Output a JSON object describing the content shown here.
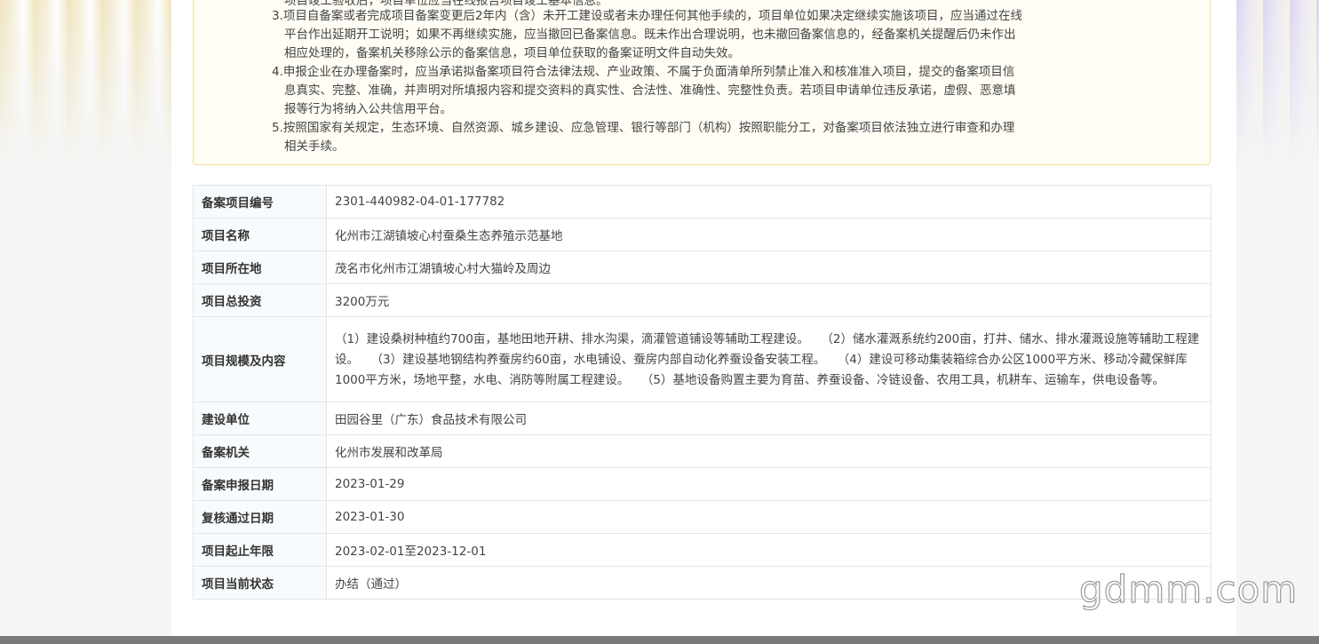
{
  "notice": {
    "lines": [
      "项目竣工验收后，项目单位应当在线报告项目竣工基本信息。",
      "3.项目自备案或者完成项目备案变更后2年内（含）未开工建设或者未办理任何其他手续的，项目单位如果决定继续实施该项目，应当通过在线",
      "平台作出延期开工说明；如果不再继续实施，应当撤回已备案信息。既未作出合理说明，也未撤回备案信息的，经备案机关提醒后仍未作出",
      "相应处理的，备案机关移除公示的备案信息，项目单位获取的备案证明文件自动失效。",
      "4.申报企业在办理备案时，应当承诺拟备案项目符合法律法规、产业政策、不属于负面清单所列禁止准入和核准准入项目，提交的备案项目信",
      "息真实、完整、准确，并声明对所填报内容和提交资料的真实性、合法性、准确性、完整性负责。若项目申请单位违反承诺，虚假、恶意填",
      "报等行为将纳入公共信用平台。",
      "5.按照国家有关规定，生态环境、自然资源、城乡建设、应急管理、银行等部门（机构）按照职能分工，对备案项目依法独立进行审查和办理",
      "相关手续。"
    ]
  },
  "table": {
    "rows": [
      {
        "label": "备案项目编号",
        "value": "2301-440982-04-01-177782"
      },
      {
        "label": "项目名称",
        "value": "化州市江湖镇坡心村蚕桑生态养殖示范基地"
      },
      {
        "label": "项目所在地",
        "value": "茂名市化州市江湖镇坡心村大猫岭及周边"
      },
      {
        "label": "项目总投资",
        "value": "3200万元"
      },
      {
        "label": "项目规模及内容",
        "value": "（1）建设桑树种植约700亩，基地田地开耕、排水沟渠，滴灌管道铺设等辅助工程建设。　　（2）储水灌溉系统约200亩，打井、储水、排水灌溉设施等辅助工程建设。　　（3）建设基地钢结构养蚕房约60亩，水电铺设、蚕房内部自动化养蚕设备安装工程。　　（4）建设可移动集装箱综合办公区1000平方米、移动冷藏保鲜库1000平方米，场地平整，水电、消防等附属工程建设。　　（5）基地设备购置主要为育苗、养蚕设备、冷链设备、农用工具，机耕车、运输车，供电设备等。"
      },
      {
        "label": "建设单位",
        "value": "田园谷里（广东）食品技术有限公司"
      },
      {
        "label": "备案机关",
        "value": "化州市发展和改革局"
      },
      {
        "label": "备案申报日期",
        "value": "2023-01-29"
      },
      {
        "label": "复核通过日期",
        "value": "2023-01-30"
      },
      {
        "label": "项目起止年限",
        "value": "2023-02-01至2023-12-01"
      },
      {
        "label": "项目当前状态",
        "value": "办结（通过）"
      }
    ]
  },
  "watermark": "gdmm.com"
}
